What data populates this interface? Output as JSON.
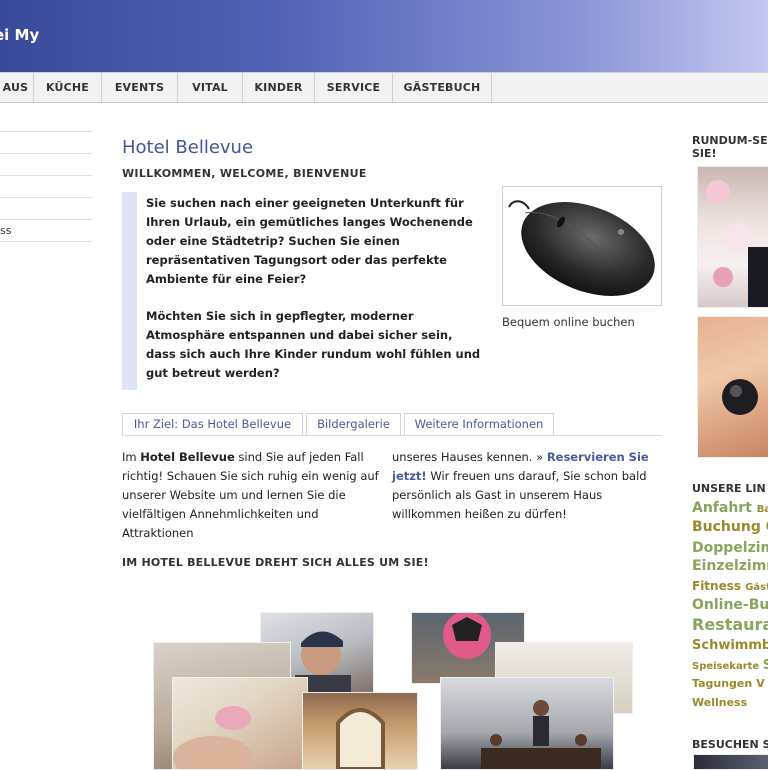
{
  "header": {
    "title": "ei My"
  },
  "nav": {
    "items": [
      "AUS",
      "KÜCHE",
      "EVENTS",
      "VITAL",
      "KINDER",
      "SERVICE",
      "GÄSTEBUCH"
    ]
  },
  "left": {
    "item": "ss"
  },
  "main": {
    "title": "Hotel Bellevue",
    "subtitle": "WILLKOMMEN, WELCOME, BIENVENUE",
    "quote1": "Sie suchen nach einer geeigneten Unterkunft für Ihren Urlaub, ein gemütliches langes Wochenende oder eine Städtetrip? Suchen Sie einen repräsentativen Tagungsort oder das perfekte Ambiente für eine Feier?",
    "quote2": "Möchten Sie sich in gepflegter, moderner Atmosphäre entspannen und dabei sicher sein, dass sich auch Ihre Kinder rundum wohl fühlen und gut betreut werden?",
    "image_caption": "Bequem online buchen",
    "tabs": [
      "Ihr Ziel: Das Hotel Bellevue",
      "Bildergalerie",
      "Weitere Informationen"
    ],
    "col1": {
      "pre": "Im ",
      "bold": "Hotel Bellevue",
      "post": " sind Sie auf jeden Fall richtig! Schauen Sie sich ruhig ein wenig auf unserer Website um und lernen Sie die vielfältigen Annehmlichkeiten und Attraktionen"
    },
    "col2": {
      "pre": "unseres Hauses kennen. » ",
      "link": "Reservieren Sie jetzt!",
      "post": " Wir freuen uns darauf, Sie schon bald persönlich als Gast in unserem Haus willkommen heißen zu dürfen!"
    },
    "section_heading": "IM HOTEL BELLEVUE DREHT SICH ALLES UM SIE!"
  },
  "right": {
    "heading1_line1": "RUNDUM-SE",
    "heading1_line2": "SIE!",
    "heading2": "UNSERE LIN",
    "heading3": "BESUCHEN S",
    "tags": [
      {
        "label": "Anfahrt",
        "extra": "Ba"
      },
      {
        "label": "Buchung O",
        "extra": ""
      },
      {
        "label": "Doppelzim",
        "extra": ""
      },
      {
        "label": "Einzelzimm",
        "extra": ""
      },
      {
        "label": "Fitness",
        "extra": "Gäst"
      },
      {
        "label": "Online-Bu",
        "extra": ""
      },
      {
        "label": "Restaura",
        "extra": ""
      },
      {
        "label": "Schwimmb",
        "extra": ""
      },
      {
        "label": "Speisekarte",
        "extra": "S"
      },
      {
        "label": "Tagungen",
        "extra": "V"
      },
      {
        "label": "Wellness",
        "extra": ""
      }
    ]
  },
  "colors": {
    "header_start": "#3a4a9a",
    "title": "#45559a",
    "tag_green": "#8aa45a",
    "tag_olive": "#9a8a2a"
  }
}
